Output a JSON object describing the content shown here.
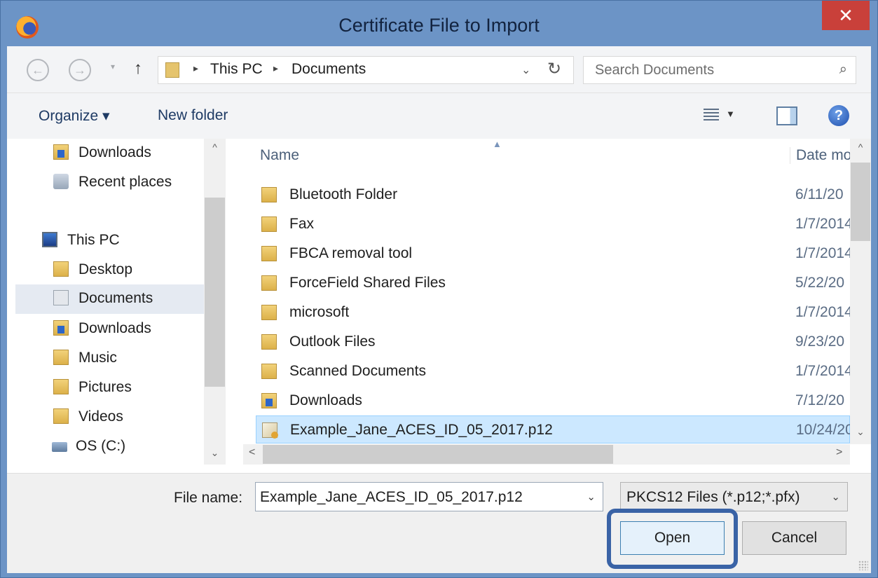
{
  "window": {
    "title": "Certificate File to Import",
    "close_glyph": "✕"
  },
  "nav": {
    "back_glyph": "←",
    "forward_glyph": "→",
    "dropdown_glyph": "▾",
    "up_glyph": "↑"
  },
  "address": {
    "crumbs": [
      "This PC",
      "Documents"
    ],
    "separator": "▸",
    "dropdown_glyph": "⌄",
    "refresh_glyph": "↻"
  },
  "search": {
    "placeholder": "Search Documents",
    "icon_glyph": "⌕"
  },
  "toolbar": {
    "organize_label": "Organize ▾",
    "new_folder_label": "New folder",
    "view_dropdown_glyph": "▼",
    "help_glyph": "?"
  },
  "sidebar": {
    "items": [
      {
        "label": "Downloads",
        "icon": "downloads-icon"
      },
      {
        "label": "Recent places",
        "icon": "recent-places-icon"
      },
      {
        "label": "This PC",
        "icon": "this-pc-icon"
      },
      {
        "label": "Desktop",
        "icon": "desktop-icon"
      },
      {
        "label": "Documents",
        "icon": "documents-icon",
        "selected": true
      },
      {
        "label": "Downloads",
        "icon": "downloads-icon"
      },
      {
        "label": "Music",
        "icon": "music-icon"
      },
      {
        "label": "Pictures",
        "icon": "pictures-icon"
      },
      {
        "label": "Videos",
        "icon": "videos-icon"
      },
      {
        "label": "OS (C:)",
        "icon": "drive-icon"
      }
    ]
  },
  "filelist": {
    "columns": {
      "name": "Name",
      "date": "Date mo"
    },
    "sort_glyph": "▲",
    "rows": [
      {
        "name": "Bluetooth Folder",
        "date": "6/11/20",
        "icon": "folder-icon"
      },
      {
        "name": "Fax",
        "date": "1/7/2014",
        "icon": "folder-icon"
      },
      {
        "name": "FBCA removal tool",
        "date": "1/7/2014",
        "icon": "folder-icon"
      },
      {
        "name": "ForceField Shared Files",
        "date": "5/22/20",
        "icon": "folder-icon"
      },
      {
        "name": "microsoft",
        "date": "1/7/2014",
        "icon": "folder-icon"
      },
      {
        "name": "Outlook Files",
        "date": "9/23/20",
        "icon": "folder-icon"
      },
      {
        "name": "Scanned Documents",
        "date": "1/7/2014",
        "icon": "folder-icon"
      },
      {
        "name": "Downloads",
        "date": "7/12/20",
        "icon": "downloads-icon"
      },
      {
        "name": "Example_Jane_ACES_ID_05_2017.p12",
        "date": "10/24/20",
        "icon": "certificate-file-icon",
        "selected": true
      }
    ]
  },
  "scroll": {
    "up_glyph": "^",
    "down_glyph": "⌄",
    "left_glyph": "<",
    "right_glyph": ">"
  },
  "footer": {
    "file_name_label": "File name:",
    "file_name_value": "Example_Jane_ACES_ID_05_2017.p12",
    "file_type_value": "PKCS12 Files (*.p12;*.pfx)",
    "dropdown_glyph": "⌄",
    "open_label": "Open",
    "cancel_label": "Cancel"
  },
  "colors": {
    "title_bar": "#6c94c6",
    "close_button": "#c9403a",
    "selection": "#cce8ff",
    "highlight_ring": "#3a63a6"
  }
}
